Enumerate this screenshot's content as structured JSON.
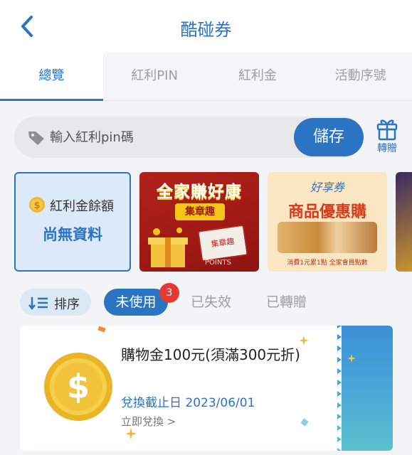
{
  "header": {
    "title": "酷碰券"
  },
  "tabs": [
    {
      "label": "總覽",
      "active": true
    },
    {
      "label": "紅利PIN",
      "active": false
    },
    {
      "label": "紅利金",
      "active": false
    },
    {
      "label": "活動序號",
      "active": false
    }
  ],
  "search": {
    "placeholder": "輸入紅利pin碼",
    "value": ""
  },
  "save_label": "儲存",
  "gift_label": "轉贈",
  "balance": {
    "label": "紅利金餘額",
    "value": "尚無資料"
  },
  "promos": {
    "p1": {
      "title": "全家賺好康",
      "sub": "集章趣",
      "stamp": "集章趣",
      "points": "POINTS"
    },
    "p2": {
      "brand": "好享券",
      "title": "商品優惠購",
      "note": "消費1元累1點 全家會員點數"
    }
  },
  "filters": {
    "sort_label": "排序",
    "unused_label": "未使用",
    "unused_count": "3",
    "expired_label": "已失效",
    "transferred_label": "已轉贈"
  },
  "coupon": {
    "title": "購物金100元(須滿300元折)",
    "expiry": "兌換截止日 2023/06/01",
    "action": "立即兌換 >"
  },
  "colors": {
    "primary": "#2b74c4",
    "badge": "#e53935",
    "background": "#f2f4f6"
  },
  "icons": [
    "back-icon",
    "tag-icon",
    "gift-icon",
    "coin-icon",
    "sort-icon"
  ]
}
